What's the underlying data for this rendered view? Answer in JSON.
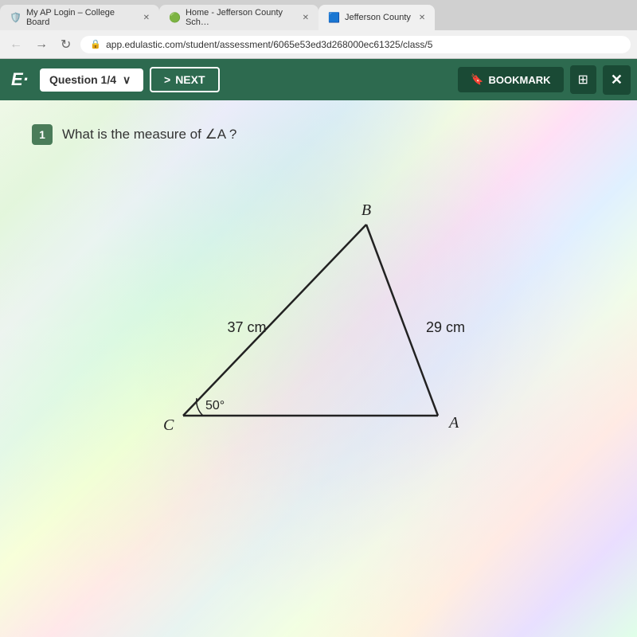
{
  "browser": {
    "tabs": [
      {
        "id": "tab1",
        "icon": "🛡️",
        "label": "My AP Login – College Board",
        "active": false
      },
      {
        "id": "tab2",
        "icon": "🟢",
        "label": "Home - Jefferson County Sch…",
        "active": false
      },
      {
        "id": "tab3",
        "icon": "🟦",
        "label": "Jefferson County",
        "active": true
      }
    ],
    "url": "app.edulastic.com/student/assessment/6065e53ed3d268000ec61325/class/5",
    "lock_icon": "🔒"
  },
  "toolbar": {
    "logo": "E·",
    "question_selector": "Question 1/4",
    "chevron": "∨",
    "next_arrow": ">",
    "next_label": "NEXT",
    "bookmark_icon": "🔖",
    "bookmark_label": "BOOKMARK",
    "grid_icon": "⊞",
    "close_icon": "✕"
  },
  "question": {
    "number": "1",
    "text": "What is the measure of ∠A ?",
    "triangle": {
      "vertices": {
        "A": "A",
        "B": "B",
        "C": "C"
      },
      "sides": {
        "AB": "37 cm",
        "BC": "29 cm",
        "angle_C": "50°"
      }
    }
  }
}
